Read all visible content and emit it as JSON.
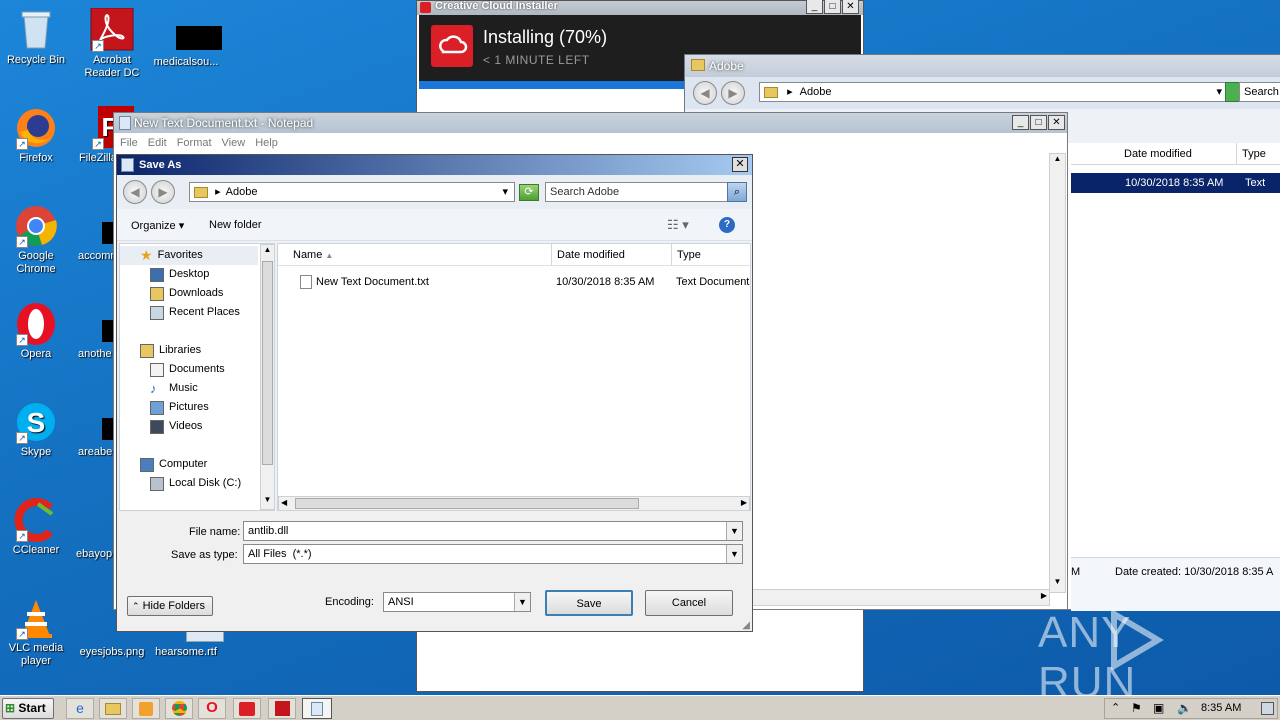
{
  "desktop": {
    "icons": [
      {
        "label": "Recycle Bin",
        "icon": "recycle-bin-icon"
      },
      {
        "label": "Acrobat Reader DC",
        "icon": "acrobat-icon"
      },
      {
        "label": "medicalsou...",
        "icon": "file-icon"
      },
      {
        "label": "Firefox",
        "icon": "firefox-icon"
      },
      {
        "label": "FileZilla",
        "icon": "filezilla-icon"
      },
      {
        "label": "Google Chrome",
        "icon": "chrome-icon"
      },
      {
        "label": "accomm",
        "icon": "file-icon"
      },
      {
        "label": "Opera",
        "icon": "opera-icon"
      },
      {
        "label": "anothe",
        "icon": "file-icon"
      },
      {
        "label": "Skype",
        "icon": "skype-icon"
      },
      {
        "label": "areabe",
        "icon": "file-icon"
      },
      {
        "label": "CCleaner",
        "icon": "ccleaner-icon"
      },
      {
        "label": "ebayop",
        "icon": "file-icon"
      },
      {
        "label": "VLC media player",
        "icon": "vlc-icon"
      },
      {
        "label": "eyesjobs.png",
        "icon": "file-icon"
      },
      {
        "label": "hearsome.rtf",
        "icon": "file-icon"
      }
    ]
  },
  "cc_installer": {
    "title": "Creative Cloud Installer",
    "status": "Installing (70%)",
    "time_left": "< 1 MINUTE LEFT",
    "progress": 0.7
  },
  "explorer": {
    "title": "Adobe",
    "path": "Adobe",
    "search_placeholder": "Search A",
    "columns": [
      "Date modified",
      "Type"
    ],
    "row": {
      "date": "10/30/2018 8:35 AM",
      "type": "Text Doc"
    },
    "details": {
      "left": "M",
      "date_created": "Date created: 10/30/2018 8:35 A"
    }
  },
  "notepad": {
    "title": "New Text Document.txt - Notepad",
    "menu": [
      "File",
      "Edit",
      "Format",
      "View",
      "Help"
    ]
  },
  "saveas": {
    "title": "Save As",
    "path": "Adobe",
    "search_placeholder": "Search Adobe",
    "organize": "Organize",
    "new_folder": "New folder",
    "nav": {
      "favorites": "Favorites",
      "fav_items": [
        "Desktop",
        "Downloads",
        "Recent Places"
      ],
      "libraries": "Libraries",
      "lib_items": [
        "Documents",
        "Music",
        "Pictures",
        "Videos"
      ],
      "computer": "Computer",
      "comp_items": [
        "Local Disk (C:)"
      ]
    },
    "columns": {
      "name": "Name",
      "date": "Date modified",
      "type": "Type"
    },
    "files": [
      {
        "name": "New Text Document.txt",
        "date": "10/30/2018 8:35 AM",
        "type": "Text Document"
      }
    ],
    "file_name_label": "File name:",
    "file_name": "antlib.dll",
    "save_type_label": "Save as type:",
    "save_type": "All Files  (*.*)",
    "hide_folders": "Hide Folders",
    "encoding_label": "Encoding:",
    "encoding": "ANSI",
    "save": "Save",
    "cancel": "Cancel"
  },
  "taskbar": {
    "start": "Start",
    "clock": "8:35 AM"
  },
  "watermark": "ANY RUN"
}
